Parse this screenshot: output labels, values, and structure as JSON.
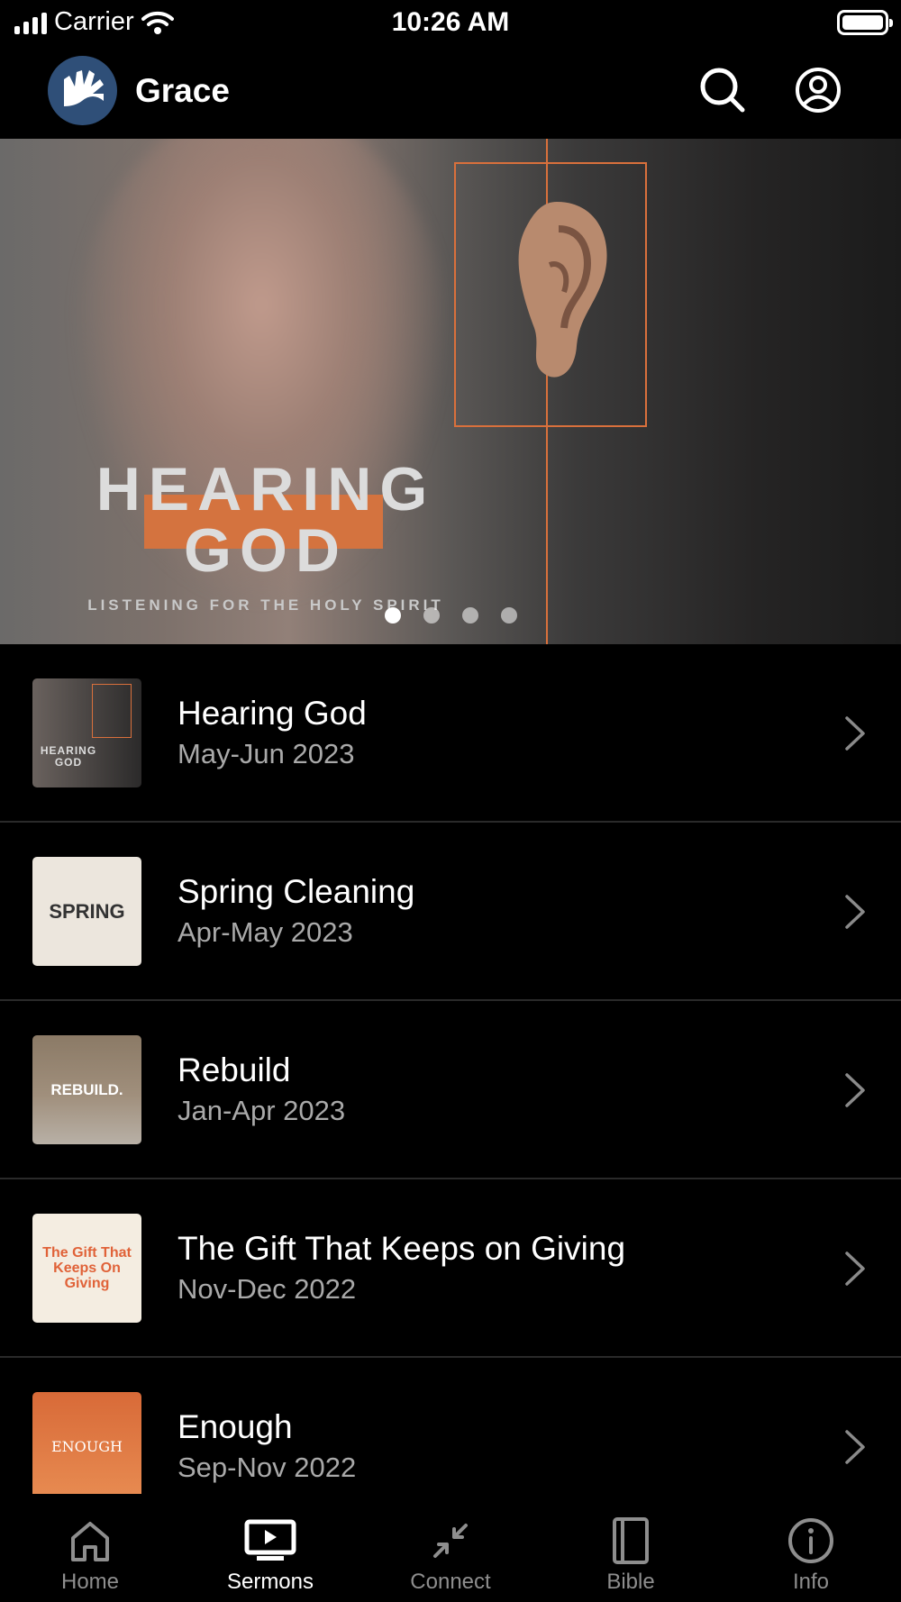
{
  "status_bar": {
    "carrier": "Carrier",
    "time": "10:26 AM"
  },
  "header": {
    "title": "Grace",
    "icons": [
      "search-icon",
      "account-icon"
    ]
  },
  "hero": {
    "title_line1": "HEARING",
    "title_line2": "GOD",
    "subtitle": "LISTENING FOR THE HOLY SPIRIT",
    "page_count": 4,
    "active_page": 1,
    "accent_color": "#d9703c"
  },
  "series": [
    {
      "title": "Hearing God",
      "date": "May-Jun 2023",
      "thumb_text": "HEARING GOD"
    },
    {
      "title": "Spring Cleaning",
      "date": "Apr-May 2023",
      "thumb_text": "SPRING"
    },
    {
      "title": "Rebuild",
      "date": "Jan-Apr 2023",
      "thumb_text": "REBUILD."
    },
    {
      "title": "The Gift That Keeps on Giving",
      "date": "Nov-Dec 2022",
      "thumb_text": "The Gift That Keeps On Giving"
    },
    {
      "title": "Enough",
      "date": "Sep-Nov 2022",
      "thumb_text": "ENOUGH"
    }
  ],
  "tabs": [
    {
      "label": "Home",
      "icon": "home-icon",
      "active": false
    },
    {
      "label": "Sermons",
      "icon": "sermons-icon",
      "active": true
    },
    {
      "label": "Connect",
      "icon": "connect-icon",
      "active": false
    },
    {
      "label": "Bible",
      "icon": "bible-icon",
      "active": false
    },
    {
      "label": "Info",
      "icon": "info-icon",
      "active": false
    }
  ],
  "colors": {
    "background": "#000000",
    "secondary_text": "#a9a9a9",
    "inactive_tab": "#8e8e8e",
    "logo_bg": "#2f4f78"
  }
}
